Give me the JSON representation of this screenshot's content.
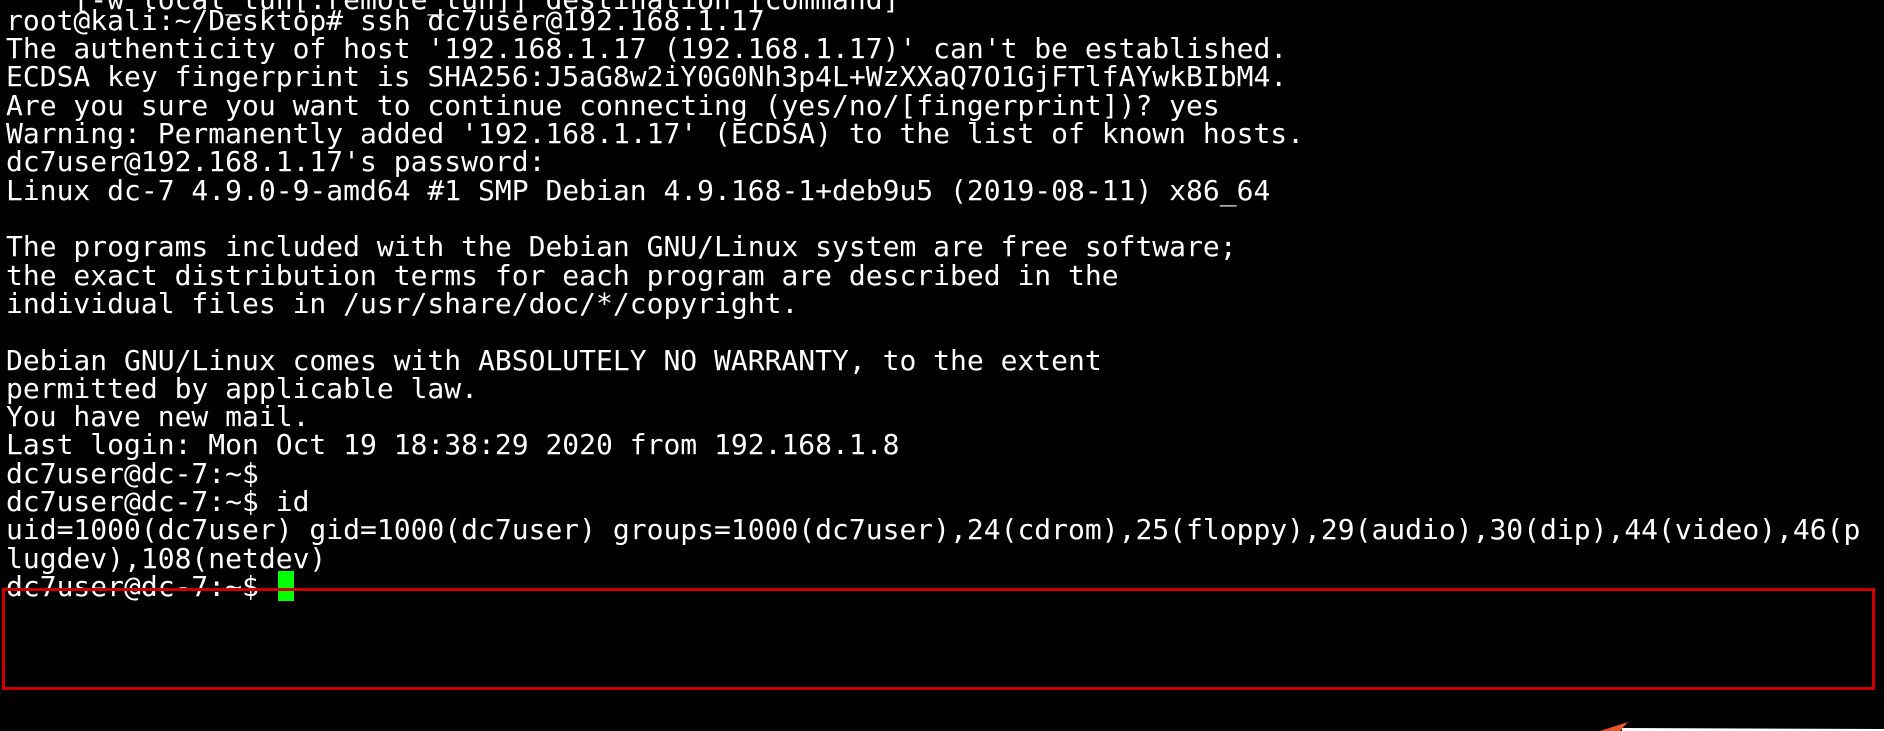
{
  "terminal": {
    "top_fragment": "    [-w local_tun[:remote_tun]] destination [command]",
    "lines": [
      "root@kali:~/Desktop# ssh dc7user@192.168.1.17",
      "The authenticity of host '192.168.1.17 (192.168.1.17)' can't be established.",
      "ECDSA key fingerprint is SHA256:J5aG8w2iY0G0Nh3p4L+WzXXaQ7O1GjFTlfAYwkBIbM4.",
      "Are you sure you want to continue connecting (yes/no/[fingerprint])? yes",
      "Warning: Permanently added '192.168.1.17' (ECDSA) to the list of known hosts.",
      "dc7user@192.168.1.17's password:",
      "Linux dc-7 4.9.0-9-amd64 #1 SMP Debian 4.9.168-1+deb9u5 (2019-08-11) x86_64",
      "",
      "The programs included with the Debian GNU/Linux system are free software;",
      "the exact distribution terms for each program are described in the",
      "individual files in /usr/share/doc/*/copyright.",
      "",
      "Debian GNU/Linux comes with ABSOLUTELY NO WARRANTY, to the extent",
      "permitted by applicable law.",
      "You have new mail.",
      "Last login: Mon Oct 19 18:38:29 2020 from 192.168.1.8",
      "dc7user@dc-7:~$",
      "dc7user@dc-7:~$ id",
      "uid=1000(dc7user) gid=1000(dc7user) groups=1000(dc7user),24(cdrom),25(floppy),29(audio),30(dip),44(video),46(p",
      "lugdev),108(netdev)"
    ],
    "prompt": "dc7user@dc-7:~$ "
  },
  "colors": {
    "background": "#000000",
    "text": "#ffffff",
    "cursor": "#00ff00",
    "highlight_border": "#cc0000",
    "arrow": "#e8562a"
  }
}
